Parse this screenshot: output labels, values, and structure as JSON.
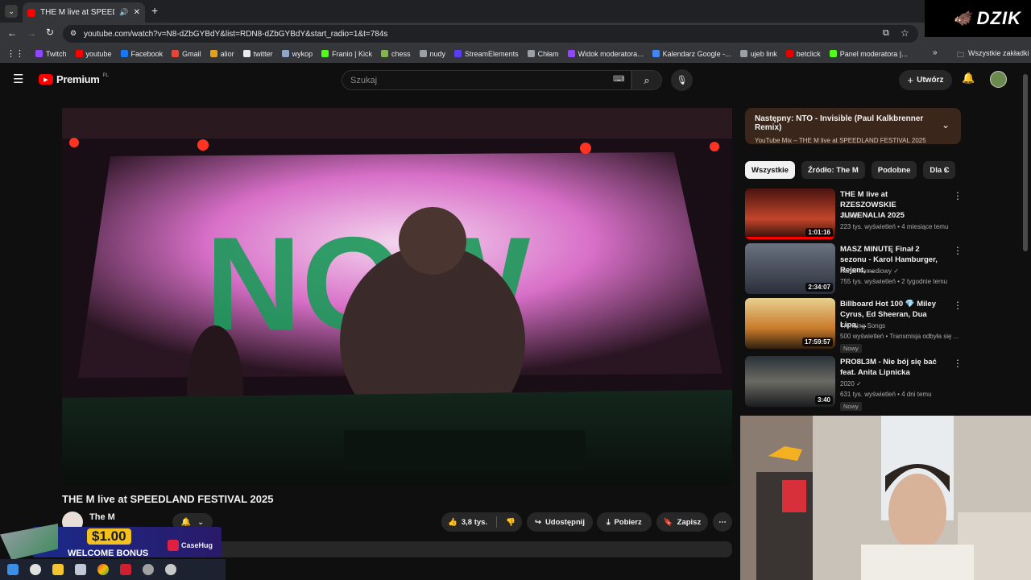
{
  "browser": {
    "tab_title": "THE M live at SPEEDLAND F",
    "url": "youtube.com/watch?v=N8-dZbGYBdY&list=RDN8-dZbGYBdY&start_radio=1&t=784s",
    "bookmarks": [
      {
        "label": "Twitch",
        "color": "#9146ff"
      },
      {
        "label": "youtube",
        "color": "#ff0000"
      },
      {
        "label": "Facebook",
        "color": "#1877f2"
      },
      {
        "label": "Gmail",
        "color": "#ea4335"
      },
      {
        "label": "alior",
        "color": "#e3a21a"
      },
      {
        "label": "twitter",
        "color": "#e8eaed"
      },
      {
        "label": "wykop",
        "color": "#8fa7c7"
      },
      {
        "label": "Franio | Kick",
        "color": "#53fc18"
      },
      {
        "label": "chess",
        "color": "#81b64c"
      },
      {
        "label": "nudy",
        "color": "#9aa0a6"
      },
      {
        "label": "StreamElements",
        "color": "#5b3df5"
      },
      {
        "label": "Chłam",
        "color": "#9aa0a6"
      },
      {
        "label": "Widok moderatora...",
        "color": "#9146ff"
      },
      {
        "label": "Kalendarz Google -...",
        "color": "#4285f4"
      },
      {
        "label": "ujeb link",
        "color": "#9aa0a6"
      },
      {
        "label": "betclick",
        "color": "#e60000"
      },
      {
        "label": "Panel moderatora |...",
        "color": "#53fc18"
      }
    ],
    "all_bookmarks": "Wszystkie zakładki"
  },
  "youtube": {
    "logo": "Premium",
    "logo_region": "PL",
    "search_placeholder": "Szukaj",
    "create_label": "Utwórz",
    "video_title": "THE M live at SPEEDLAND FESTIVAL 2025",
    "channel": "The M",
    "likes": "3,8 tys.",
    "share_label": "Udostępnij",
    "download_label": "Pobierz",
    "save_label": "Zapisz",
    "video_text": "NOW",
    "up_next": {
      "title": "Następny: NTO - Invisible (Paul Kalkbrenner Remix)",
      "subtitle": "YouTube Mix – THE M live at SPEEDLAND FESTIVAL 2025"
    },
    "chips": [
      "Wszystkie",
      "Źródło: The M",
      "Podobne",
      "Dla C"
    ],
    "recommendations": [
      {
        "title": "THE M live at RZESZOWSKIE JUWENALIA 2025",
        "channel": "The M",
        "meta": "223 tys. wyświetleń • 4 miesiące temu",
        "duration": "1:01:16",
        "badge": ""
      },
      {
        "title": "MASZ MINUTĘ Finał 2 sezonu - Karol Hamburger, Rejent, ...",
        "channel": "Kanał Komediowy ✓",
        "meta": "755 tys. wyświetleń • 2 tygodnie temu",
        "duration": "2:34:07",
        "badge": ""
      },
      {
        "title": "Billboard Hot 100 💎 Miley Cyrus, Ed Sheeran, Dua Lipa, ...",
        "channel": "Trending Songs",
        "meta": "500 wyświetleń • Transmisja odbyła się ...",
        "duration": "17:59:57",
        "badge": "Nowy"
      },
      {
        "title": "PRO8L3M - Nie bój się bać feat. Anita Lipnicka",
        "channel": "2020 ✓",
        "meta": "631 tys. wyświetleń • 4 dni temu",
        "duration": "3:40",
        "badge": "Nowy"
      }
    ]
  },
  "overlay": {
    "stream_logo": "DZIK",
    "ad_amount": "$1.00",
    "ad_text": "WELCOME BONUS",
    "ad_brand": "CaseHug"
  }
}
